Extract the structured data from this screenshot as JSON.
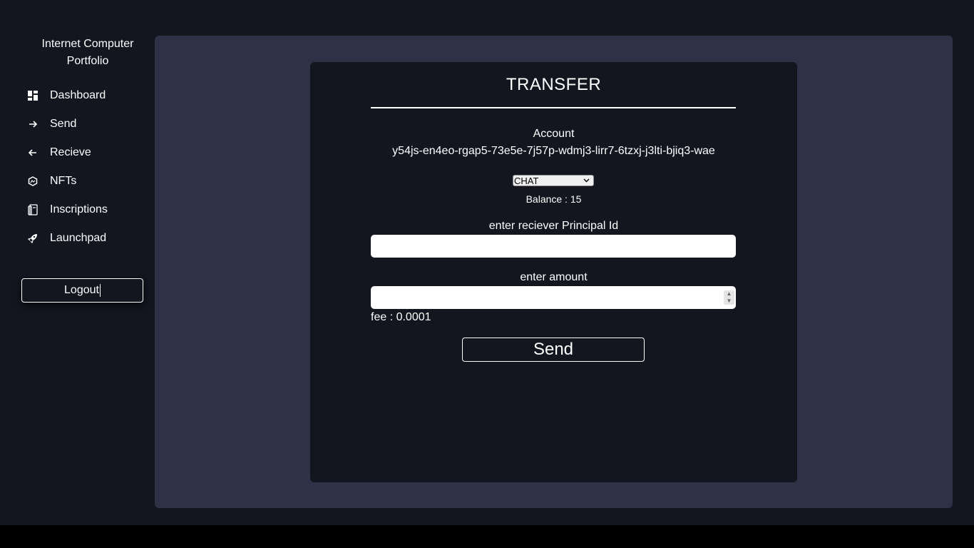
{
  "sidebar": {
    "brand": "Internet Computer Portfolio",
    "items": [
      {
        "label": "Dashboard",
        "icon": "dashboard-icon"
      },
      {
        "label": "Send",
        "icon": "arrow-right-icon"
      },
      {
        "label": "Recieve",
        "icon": "arrow-left-icon"
      },
      {
        "label": "NFTs",
        "icon": "nft-icon"
      },
      {
        "label": "Inscriptions",
        "icon": "inscriptions-icon"
      },
      {
        "label": "Launchpad",
        "icon": "rocket-icon"
      }
    ],
    "logout_label": "Logout"
  },
  "transfer": {
    "title": "TRANSFER",
    "account_label": "Account",
    "account_id": "y54js-en4eo-rgap5-73e5e-7j57p-wdmj3-lirr7-6tzxj-j3lti-bjiq3-wae",
    "token_selected": "CHAT",
    "balance": "Balance : 15",
    "principal_label": "enter reciever Principal Id",
    "principal_value": "",
    "amount_label": "enter amount",
    "amount_value": "",
    "fee": "fee : 0.0001",
    "send_label": "Send"
  },
  "colors": {
    "background": "#13151f",
    "panel": "#2e3247",
    "text": "#ffffff"
  }
}
